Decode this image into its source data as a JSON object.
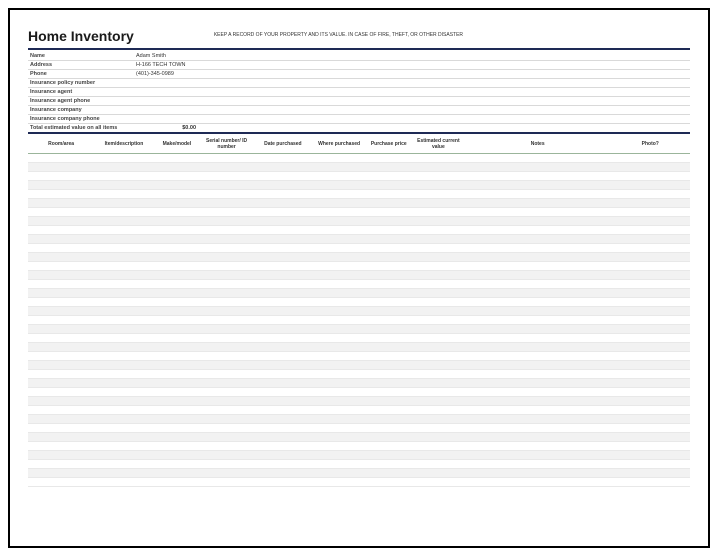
{
  "title": "Home Inventory",
  "subtitle": "KEEP A RECORD OF YOUR PROPERTY AND ITS VALUE. IN CASE OF FIRE, THEFT, OR OTHER DISASTER",
  "info": {
    "rows": [
      {
        "label": "Name",
        "value": "Adam Smith"
      },
      {
        "label": "Address",
        "value": "H-166 TECH TOWN"
      },
      {
        "label": "Phone",
        "value": "(401)-345-0989"
      },
      {
        "label": "Insurance policy number",
        "value": ""
      },
      {
        "label": "Insurance agent",
        "value": ""
      },
      {
        "label": "Insurance agent phone",
        "value": ""
      },
      {
        "label": "Insurance company",
        "value": ""
      },
      {
        "label": "Insurance company phone",
        "value": ""
      }
    ],
    "total_label": "Total estimated value on all items",
    "total_value": "$0.00"
  },
  "columns": [
    "Room/area",
    "Item/description",
    "Make/model",
    "Serial number/ ID number",
    "Date purchased",
    "Where purchased",
    "Purchase price",
    "Estimated current value",
    "Notes",
    "Photo?"
  ],
  "row_count": 37
}
